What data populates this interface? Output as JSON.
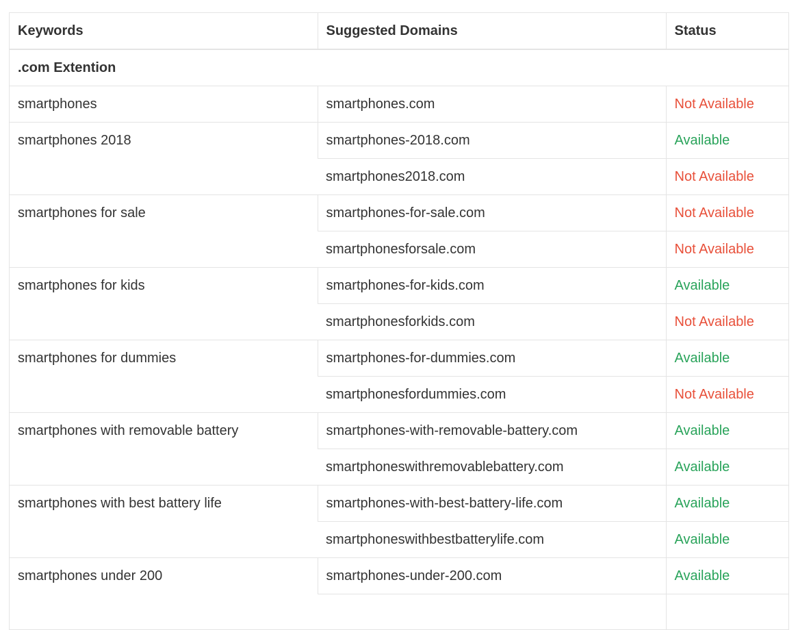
{
  "table": {
    "headers": [
      "Keywords",
      "Suggested Domains",
      "Status"
    ],
    "section": ".com Extention",
    "groups": [
      {
        "keyword": "smartphones",
        "domains": [
          {
            "domain": "smartphones.com",
            "status": "Not Available",
            "available": false
          }
        ]
      },
      {
        "keyword": "smartphones 2018",
        "domains": [
          {
            "domain": "smartphones-2018.com",
            "status": "Available",
            "available": true
          },
          {
            "domain": "smartphones2018.com",
            "status": "Not Available",
            "available": false
          }
        ]
      },
      {
        "keyword": "smartphones for sale",
        "domains": [
          {
            "domain": "smartphones-for-sale.com",
            "status": "Not Available",
            "available": false
          },
          {
            "domain": "smartphonesforsale.com",
            "status": "Not Available",
            "available": false
          }
        ]
      },
      {
        "keyword": "smartphones for kids",
        "domains": [
          {
            "domain": "smartphones-for-kids.com",
            "status": "Available",
            "available": true
          },
          {
            "domain": "smartphonesforkids.com",
            "status": "Not Available",
            "available": false
          }
        ]
      },
      {
        "keyword": "smartphones for dummies",
        "domains": [
          {
            "domain": "smartphones-for-dummies.com",
            "status": "Available",
            "available": true
          },
          {
            "domain": "smartphonesfordummies.com",
            "status": "Not Available",
            "available": false
          }
        ]
      },
      {
        "keyword": "smartphones with removable battery",
        "domains": [
          {
            "domain": "smartphones-with-removable-battery.com",
            "status": "Available",
            "available": true
          },
          {
            "domain": "smartphoneswithremovablebattery.com",
            "status": "Available",
            "available": true
          }
        ]
      },
      {
        "keyword": "smartphones with best battery life",
        "domains": [
          {
            "domain": "smartphones-with-best-battery-life.com",
            "status": "Available",
            "available": true
          },
          {
            "domain": "smartphoneswithbestbatterylife.com",
            "status": "Available",
            "available": true
          }
        ]
      },
      {
        "keyword": "smartphones under 200",
        "domains": [
          {
            "domain": "smartphones-under-200.com",
            "status": "Available",
            "available": true
          },
          {
            "domain": "",
            "status": "",
            "available": true
          }
        ]
      }
    ]
  },
  "colors": {
    "available": "#29a35a",
    "not_available": "#e8503a",
    "border": "#e4e4e4",
    "text": "#333333"
  }
}
